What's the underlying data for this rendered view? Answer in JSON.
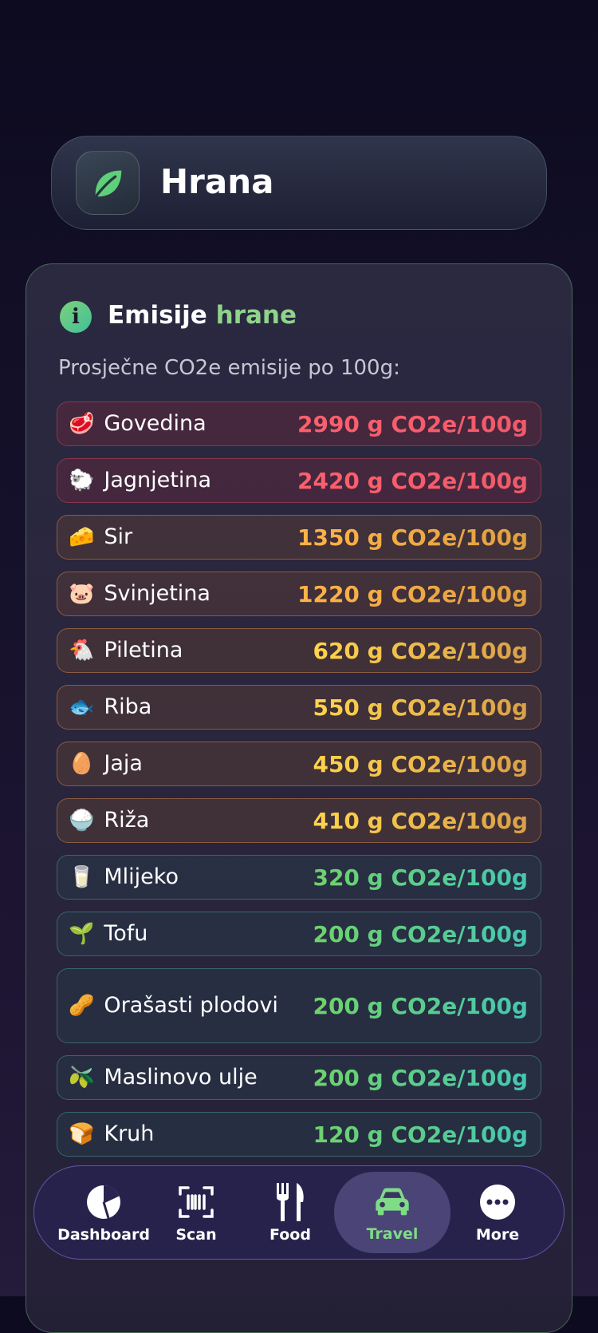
{
  "header": {
    "title": "Hrana",
    "icon": "leaf-icon"
  },
  "card": {
    "title_part1": "Emisije",
    "title_part2": "hrane",
    "subtitle": "Prosječne CO2e emisije po 100g:",
    "items": [
      {
        "emoji": "🥩",
        "name": "Govedina",
        "value": "2990 g CO2e/100g",
        "level": "red"
      },
      {
        "emoji": "🐑",
        "name": "Jagnjetina",
        "value": "2420 g CO2e/100g",
        "level": "red"
      },
      {
        "emoji": "🧀",
        "name": "Sir",
        "value": "1350 g CO2e/100g",
        "level": "orange"
      },
      {
        "emoji": "🐷",
        "name": "Svinjetina",
        "value": "1220 g CO2e/100g",
        "level": "orange"
      },
      {
        "emoji": "🐔",
        "name": "Piletina",
        "value": "620 g CO2e/100g",
        "level": "yellow"
      },
      {
        "emoji": "🐟",
        "name": "Riba",
        "value": "550 g CO2e/100g",
        "level": "yellow"
      },
      {
        "emoji": "🥚",
        "name": "Jaja",
        "value": "450 g CO2e/100g",
        "level": "yellow"
      },
      {
        "emoji": "🍚",
        "name": "Riža",
        "value": "410 g CO2e/100g",
        "level": "yellow"
      },
      {
        "emoji": "🥛",
        "name": "Mlijeko",
        "value": "320 g CO2e/100g",
        "level": "green"
      },
      {
        "emoji": "🌱",
        "name": "Tofu",
        "value": "200 g CO2e/100g",
        "level": "green"
      },
      {
        "emoji": "🥜",
        "name": "Orašasti plodovi",
        "value": "200 g CO2e/100g",
        "level": "green"
      },
      {
        "emoji": "🫒",
        "name": "Maslinovo ulje",
        "value": "200 g CO2e/100g",
        "level": "green"
      },
      {
        "emoji": "🍞",
        "name": "Kruh",
        "value": "120 g CO2e/100g",
        "level": "green"
      }
    ]
  },
  "nav": {
    "items": [
      {
        "label": "Dashboard",
        "icon": "pie-chart-icon"
      },
      {
        "label": "Scan",
        "icon": "barcode-scan-icon"
      },
      {
        "label": "Food",
        "icon": "fork-knife-icon"
      },
      {
        "label": "Travel",
        "icon": "car-icon",
        "active": true
      },
      {
        "label": "More",
        "icon": "more-dots-icon"
      }
    ]
  },
  "colors": {
    "accent_green": "#7fdc86",
    "red": "#f05a6a",
    "orange": "#ffb347",
    "yellow": "#ffd54a",
    "green": "#6fd36a"
  }
}
